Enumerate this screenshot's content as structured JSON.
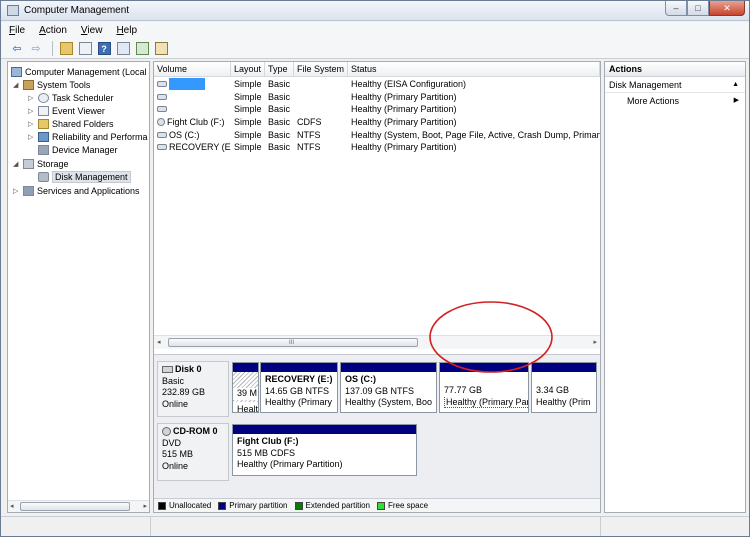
{
  "window": {
    "title": "Computer Management",
    "btn_min": "–",
    "btn_max": "□",
    "btn_close": "✕"
  },
  "menu": [
    {
      "id": "file",
      "hotkey": "F",
      "rest": "ile"
    },
    {
      "id": "action",
      "hotkey": "A",
      "rest": "ction"
    },
    {
      "id": "view",
      "hotkey": "V",
      "rest": "iew"
    },
    {
      "id": "help",
      "hotkey": "H",
      "rest": "elp"
    }
  ],
  "toolbar": {
    "back_glyph": "⇦",
    "forward_glyph": "⇨",
    "help_glyph": "?"
  },
  "tree": {
    "root": "Computer Management (Local",
    "system_tools": "System Tools",
    "task_scheduler": "Task Scheduler",
    "event_viewer": "Event Viewer",
    "shared_folders": "Shared Folders",
    "reliability": "Reliability and Performa",
    "device_manager": "Device Manager",
    "storage": "Storage",
    "disk_management": "Disk Management",
    "services": "Services and Applications",
    "expanded_glyph": "◢",
    "collapsed_glyph": "▷"
  },
  "volumes": {
    "headers": [
      "Volume",
      "Layout",
      "Type",
      "File System",
      "Status"
    ],
    "rows": [
      {
        "name": "",
        "layout": "Simple",
        "type": "Basic",
        "fs": "",
        "status": "Healthy (EISA Configuration)",
        "selected": true
      },
      {
        "name": "",
        "layout": "Simple",
        "type": "Basic",
        "fs": "",
        "status": "Healthy (Primary Partition)"
      },
      {
        "name": "",
        "layout": "Simple",
        "type": "Basic",
        "fs": "",
        "status": "Healthy (Primary Partition)"
      },
      {
        "name": "Fight Club (F:)",
        "layout": "Simple",
        "type": "Basic",
        "fs": "CDFS",
        "status": "Healthy (Primary Partition)"
      },
      {
        "name": "OS (C:)",
        "layout": "Simple",
        "type": "Basic",
        "fs": "NTFS",
        "status": "Healthy (System, Boot, Page File, Active, Crash Dump, Primary"
      },
      {
        "name": "RECOVERY (E:)",
        "layout": "Simple",
        "type": "Basic",
        "fs": "NTFS",
        "status": "Healthy (Primary Partition)"
      }
    ]
  },
  "scroll": {
    "left": "◂",
    "right": "▸",
    "grip": "III"
  },
  "disks": [
    {
      "id": "disk0",
      "name": "Disk 0",
      "type": "Basic",
      "size": "232.89 GB",
      "state": "Online",
      "partitions": [
        {
          "title": "",
          "size": "39 M",
          "status": "Healt"
        },
        {
          "title": "RECOVERY  (E:)",
          "size": "14.65 GB NTFS",
          "status": "Healthy (Primary"
        },
        {
          "title": "OS  (C:)",
          "size": "137.09 GB NTFS",
          "status": "Healthy (System, Boo"
        },
        {
          "title": "",
          "size": "77.77 GB",
          "status": "Healthy (Primary Partition)"
        },
        {
          "title": "",
          "size": "3.34 GB",
          "status": "Healthy (Prim"
        }
      ]
    },
    {
      "id": "cdrom0",
      "name": "CD-ROM 0",
      "type": "DVD",
      "size": "515 MB",
      "state": "Online",
      "partitions": [
        {
          "title": "Fight Club  (F:)",
          "size": "515 MB CDFS",
          "status": "Healthy (Primary Partition)"
        }
      ]
    }
  ],
  "legend": [
    {
      "label": "Unallocated",
      "color": "#000000"
    },
    {
      "label": "Primary partition",
      "color": "#000080"
    },
    {
      "label": "Extended partition",
      "color": "#008000"
    },
    {
      "label": "Free space",
      "color": "#33dd33"
    }
  ],
  "actions": {
    "header": "Actions",
    "section": "Disk Management",
    "section_caret": "▲",
    "more": "More Actions",
    "more_caret": "▶"
  },
  "colors": {
    "primary_partition": "#000080",
    "selection": "#3399ff",
    "annotation": "#d42020"
  }
}
